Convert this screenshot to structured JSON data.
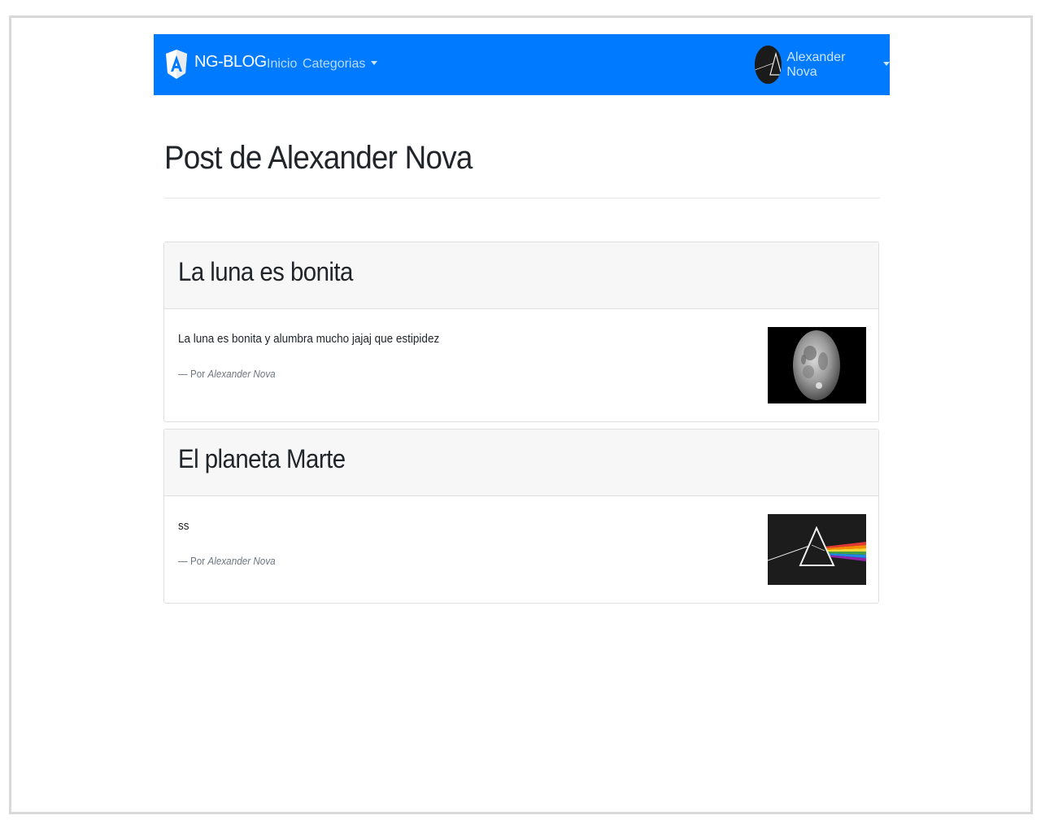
{
  "navbar": {
    "brand": "NG-BLOG",
    "links": [
      {
        "label": "Inicio"
      },
      {
        "label": "Categorias"
      }
    ],
    "user": {
      "name": "Alexander Nova"
    },
    "colors": {
      "background": "#007bff",
      "text": "#ffffff"
    }
  },
  "page": {
    "title": "Post de Alexander Nova"
  },
  "posts": [
    {
      "title": "La luna es bonita",
      "text": "La luna es bonita y alumbra mucho jajaj que estipidez",
      "author_prefix": "— Por",
      "author": "Alexander Nova",
      "image_icon": "moon-image"
    },
    {
      "title": "El planeta Marte",
      "text": "ss",
      "author_prefix": "— Por",
      "author": "Alexander Nova",
      "image_icon": "prism-image"
    }
  ]
}
